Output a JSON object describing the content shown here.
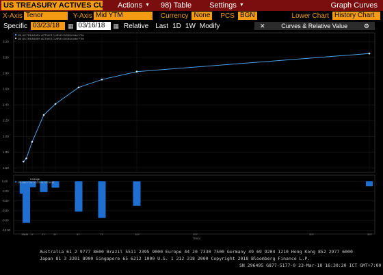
{
  "toolbar": {
    "title": "US TREASURY ACTIVES CURV",
    "actions_label": "Actions",
    "table_label": "98) Table",
    "settings_label": "Settings",
    "graph_curves_label": "Graph Curves"
  },
  "controls": {
    "xaxis_label": "X-Axis",
    "xaxis_value": "Tenor",
    "yaxis_label": "Y-Axis",
    "yaxis_value": "Mid YTM",
    "currency_label": "Currency",
    "currency_value": "None",
    "pcs_label": "PCS",
    "pcs_value": "BGN",
    "lower_chart_label": "Lower Chart",
    "lower_chart_value": "History Chart"
  },
  "date_bar": {
    "specific_label": "Specific",
    "date1": "03/23/18",
    "date2": "03/16/18",
    "relative_label": "Relative",
    "last_label": "Last",
    "btn_1d": "1D",
    "btn_1w": "1W",
    "modify_label": "Modify",
    "curves_label": "Curves & Relative Value",
    "gear": "⚙"
  },
  "legend": {
    "line1": "I25 US TREASURY ACTIVES CURVE 03/23/18 Mid YTM",
    "line2": "I25 US TREASURY ACTIVES CURVE 03/16/18 Mid YTM",
    "lower1": "Change",
    "lower2": "I25 Mid YTM 03/23/18-03/16/18"
  },
  "chart_data": {
    "type": "line",
    "upper": {
      "x": [
        0.25,
        0.5,
        1,
        2,
        3,
        5,
        7,
        10,
        30
      ],
      "x_tick_labels": [
        "3M",
        "6M",
        "1Y",
        "2Y",
        "3Y",
        "5Y",
        "7Y",
        "10Y",
        "30Y"
      ],
      "series": [
        {
          "values": [
            1.68,
            1.72,
            1.93,
            2.27,
            2.41,
            2.62,
            2.72,
            2.82,
            3.05
          ]
        }
      ],
      "y_tick_labels": [
        "1.60",
        "1.80",
        "2.00",
        "2.20",
        "2.40",
        "2.60",
        "2.80",
        "3.00",
        "3.20"
      ],
      "ylim": [
        1.56,
        3.26
      ],
      "grid": true,
      "color": "#4aa3e8"
    },
    "lower": {
      "type": "bar",
      "x": [
        0.25,
        0.5,
        1,
        2,
        3,
        5,
        7,
        10,
        30
      ],
      "values": [
        -2.5,
        -8.5,
        -1.2,
        -2.2,
        -1.3,
        -6.2,
        -7.5,
        -5.0,
        -1.0
      ],
      "y_tick_labels": [
        "0.00",
        "-2.00",
        "-4.00",
        "-6.00",
        "-8.00",
        "-10.00"
      ],
      "ylim": [
        -10.5,
        1.0
      ],
      "color": "#1f6fd1"
    },
    "xlabel": "Tenor",
    "bottom_tick_labels": [
      "3M",
      "6M",
      "1Y",
      "2Y",
      "3Y",
      "5Y",
      "7Y",
      "10Y",
      "20Y",
      "30Y",
      "30Y"
    ]
  },
  "footer": {
    "line1": "Australia 61 2 9777 8600 Brazil 5511 2395 9000 Europe 44 20 7330 7500 Germany 49 69 9204 1210 Hong Kong 852 2977 6000",
    "line2": "Japan 81 3 3201 8900        Singapore 65 6212 1000        U.S. 1 212 318 2000           Copyright 2018 Bloomberg Finance L.P.",
    "line3": "SN 296495 G877-5177-0 23-Mar-18 16:30:20 ICT GMT+7:00"
  }
}
